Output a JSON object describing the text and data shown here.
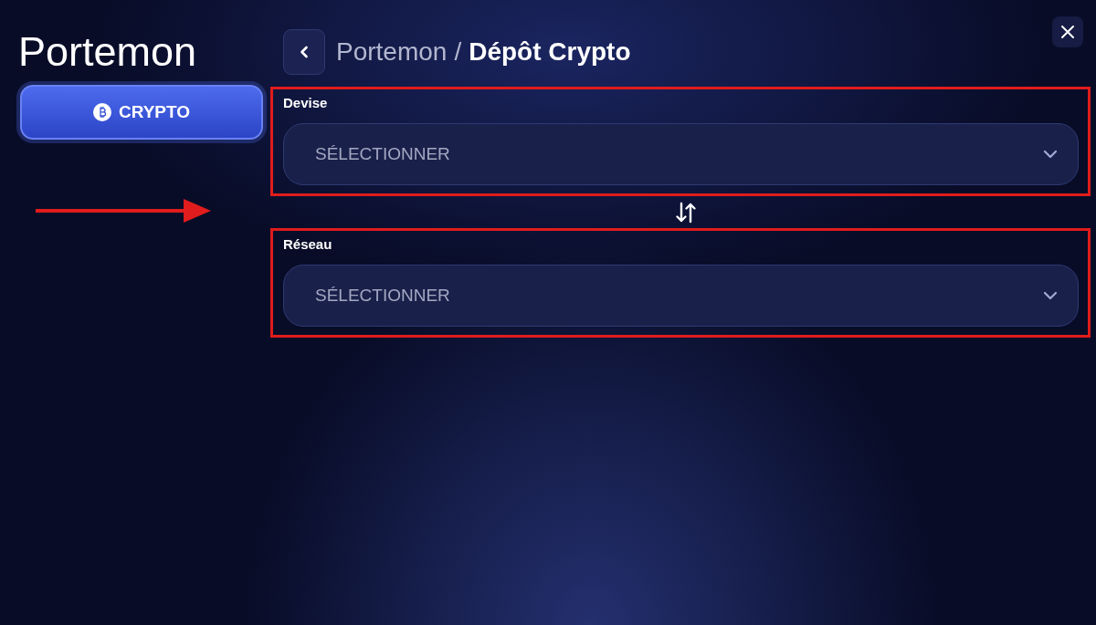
{
  "sidebar": {
    "title": "Portemon",
    "items": [
      {
        "label": "CRYPTO",
        "selected": true
      }
    ]
  },
  "header": {
    "breadcrumb": {
      "parent": "Portemon",
      "separator": "/",
      "current": "Dépôt Crypto"
    }
  },
  "fields": [
    {
      "label": "Devise",
      "placeholder": "SÉLECTIONNER",
      "highlighted": true
    },
    {
      "label": "Réseau",
      "placeholder": "SÉLECTIONNER",
      "highlighted": true
    }
  ]
}
